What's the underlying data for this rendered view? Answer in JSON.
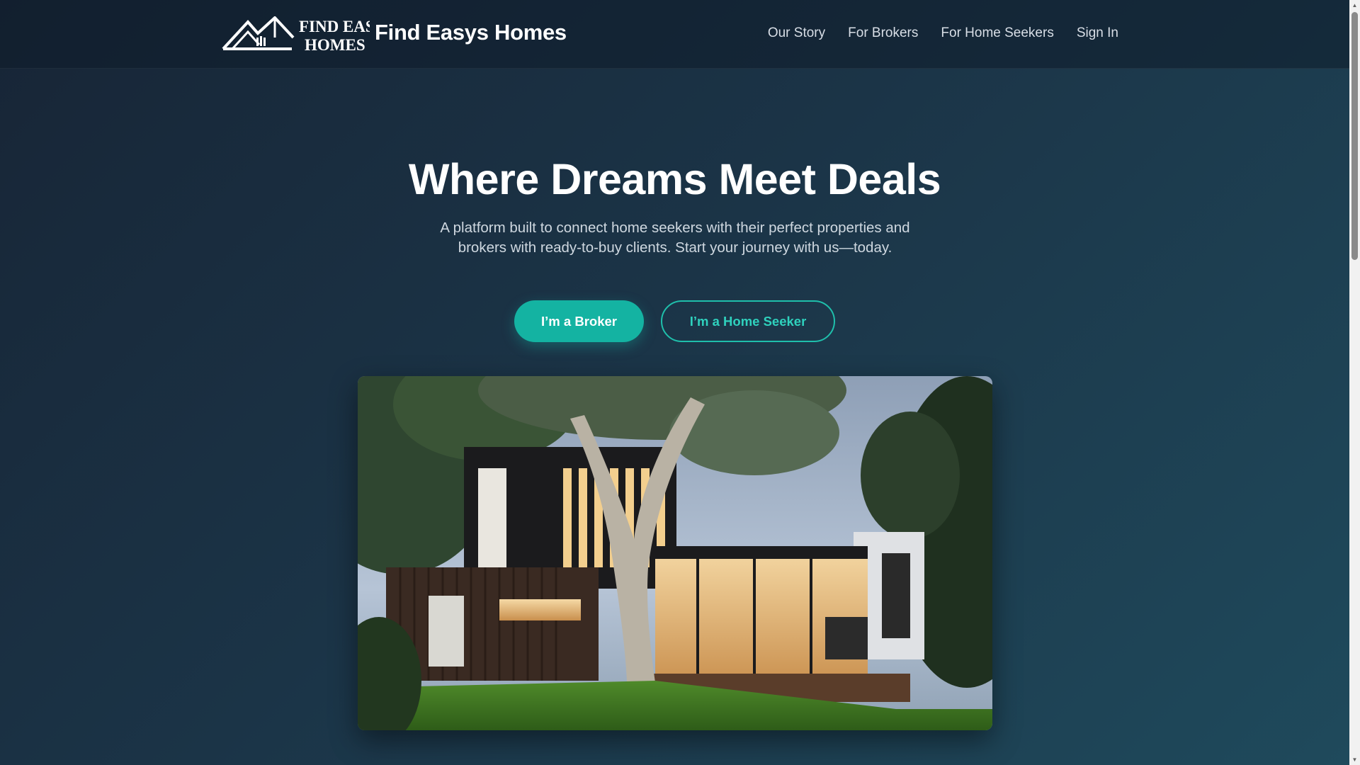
{
  "header": {
    "logo_text_line1": "FIND EASY",
    "logo_text_line2": "HOMES",
    "brand_name": "Find Easys Homes",
    "nav": [
      {
        "label": "Our Story"
      },
      {
        "label": "For Brokers"
      },
      {
        "label": "For Home Seekers"
      },
      {
        "label": "Sign In"
      }
    ]
  },
  "hero": {
    "title": "Where Dreams Meet Deals",
    "subtitle": "A platform built to connect home seekers with their perfect properties and brokers with ready-to-buy clients. Start your journey with us—today.",
    "primary_button": "I’m a Broker",
    "secondary_button": "I’m a Home Seeker",
    "image_icon": "modern-house-photo"
  },
  "colors": {
    "background_start": "#172536",
    "background_end": "#1f4a5c",
    "accent": "#14b3a2",
    "accent_text": "#2fd1bd"
  },
  "icons": {
    "logo": "house-roof-logo-icon",
    "scroll_up": "triangle-up-icon",
    "scroll_down": "triangle-down-icon"
  }
}
